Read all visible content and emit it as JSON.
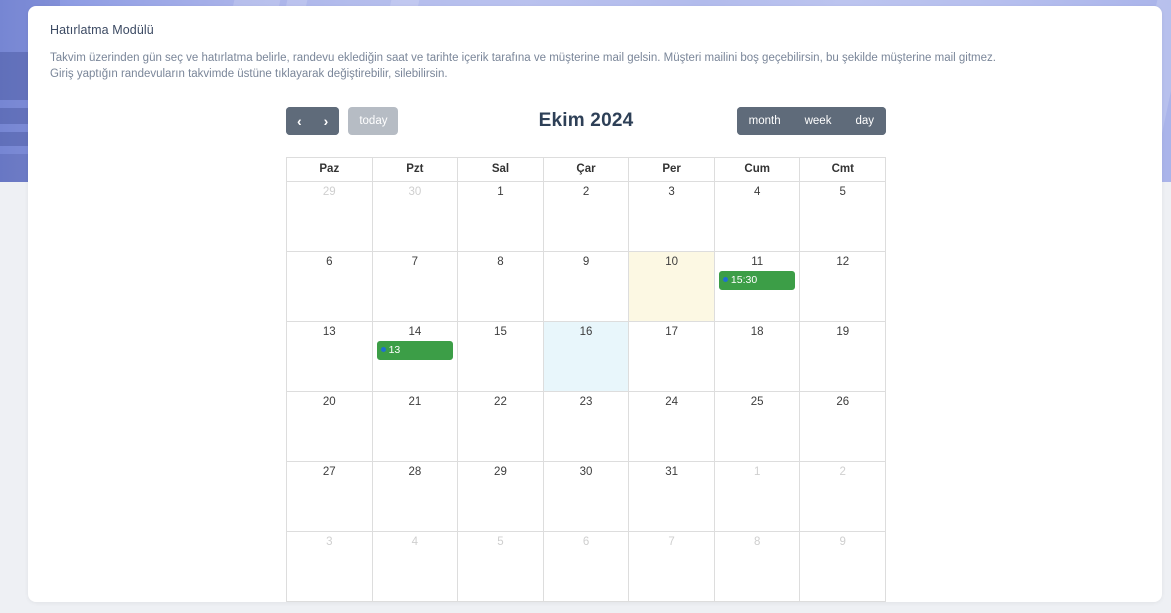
{
  "module": {
    "title": "Hatırlatma Modülü",
    "desc_line1": "Takvim üzerinden gün seç ve hatırlatma belirle, randevu eklediğin saat ve tarihte içerik tarafına ve müşterine mail gelsin. Müşteri mailini boş geçebilirsin, bu şekilde müşterine mail gitmez.",
    "desc_line2": "Giriş yaptığın randevuların takvimde üstüne tıklayarak değiştirebilir, silebilirsin."
  },
  "calendar": {
    "title": "Ekim 2024",
    "toolbar": {
      "prev": "‹",
      "next": "›",
      "today": "today",
      "view_month": "month",
      "view_week": "week",
      "view_day": "day"
    },
    "weekdays": [
      "Paz",
      "Pzt",
      "Sal",
      "Çar",
      "Per",
      "Cum",
      "Cmt"
    ],
    "colors": {
      "event_green": "#3c9e47",
      "event_dot_blue": "#1f6fd0",
      "highlight_cream": "#fcf8e3",
      "today_blue": "#e8f6fb",
      "toolbar_gray": "#5f6b7a",
      "today_button_gray": "#b6bcc4",
      "title_navy": "#2e4057"
    },
    "weeks": [
      [
        {
          "day": "29",
          "other": true,
          "state": "",
          "events": []
        },
        {
          "day": "30",
          "other": true,
          "state": "",
          "events": []
        },
        {
          "day": "1",
          "other": false,
          "state": "",
          "events": []
        },
        {
          "day": "2",
          "other": false,
          "state": "",
          "events": []
        },
        {
          "day": "3",
          "other": false,
          "state": "",
          "events": []
        },
        {
          "day": "4",
          "other": false,
          "state": "",
          "events": []
        },
        {
          "day": "5",
          "other": false,
          "state": "",
          "events": []
        }
      ],
      [
        {
          "day": "6",
          "other": false,
          "state": "",
          "events": []
        },
        {
          "day": "7",
          "other": false,
          "state": "",
          "events": []
        },
        {
          "day": "8",
          "other": false,
          "state": "",
          "events": []
        },
        {
          "day": "9",
          "other": false,
          "state": "",
          "events": []
        },
        {
          "day": "10",
          "other": false,
          "state": "highlight",
          "events": []
        },
        {
          "day": "11",
          "other": false,
          "state": "",
          "events": [
            {
              "label": "15:30"
            }
          ]
        },
        {
          "day": "12",
          "other": false,
          "state": "",
          "events": []
        }
      ],
      [
        {
          "day": "13",
          "other": false,
          "state": "",
          "events": []
        },
        {
          "day": "14",
          "other": false,
          "state": "",
          "events": [
            {
              "label": "13"
            }
          ]
        },
        {
          "day": "15",
          "other": false,
          "state": "",
          "events": []
        },
        {
          "day": "16",
          "other": false,
          "state": "today",
          "events": []
        },
        {
          "day": "17",
          "other": false,
          "state": "",
          "events": []
        },
        {
          "day": "18",
          "other": false,
          "state": "",
          "events": []
        },
        {
          "day": "19",
          "other": false,
          "state": "",
          "events": []
        }
      ],
      [
        {
          "day": "20",
          "other": false,
          "state": "",
          "events": []
        },
        {
          "day": "21",
          "other": false,
          "state": "",
          "events": []
        },
        {
          "day": "22",
          "other": false,
          "state": "",
          "events": []
        },
        {
          "day": "23",
          "other": false,
          "state": "",
          "events": []
        },
        {
          "day": "24",
          "other": false,
          "state": "",
          "events": []
        },
        {
          "day": "25",
          "other": false,
          "state": "",
          "events": []
        },
        {
          "day": "26",
          "other": false,
          "state": "",
          "events": []
        }
      ],
      [
        {
          "day": "27",
          "other": false,
          "state": "",
          "events": []
        },
        {
          "day": "28",
          "other": false,
          "state": "",
          "events": []
        },
        {
          "day": "29",
          "other": false,
          "state": "",
          "events": []
        },
        {
          "day": "30",
          "other": false,
          "state": "",
          "events": []
        },
        {
          "day": "31",
          "other": false,
          "state": "",
          "events": []
        },
        {
          "day": "1",
          "other": true,
          "state": "",
          "events": []
        },
        {
          "day": "2",
          "other": true,
          "state": "",
          "events": []
        }
      ],
      [
        {
          "day": "3",
          "other": true,
          "state": "",
          "events": []
        },
        {
          "day": "4",
          "other": true,
          "state": "",
          "events": []
        },
        {
          "day": "5",
          "other": true,
          "state": "",
          "events": []
        },
        {
          "day": "6",
          "other": true,
          "state": "",
          "events": []
        },
        {
          "day": "7",
          "other": true,
          "state": "",
          "events": []
        },
        {
          "day": "8",
          "other": true,
          "state": "",
          "events": []
        },
        {
          "day": "9",
          "other": true,
          "state": "",
          "events": []
        }
      ]
    ]
  }
}
